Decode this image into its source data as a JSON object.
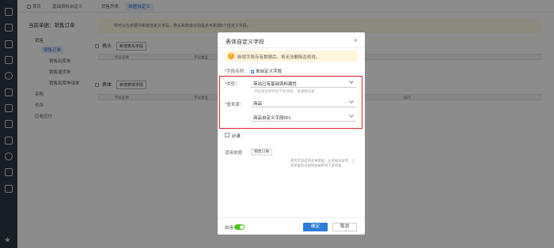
{
  "tabs": [
    "首页",
    "基础资料自定义",
    "销售列表",
    "单据自定义"
  ],
  "breadcrumb": "当前单据：销售订单",
  "tree": {
    "group": "销售",
    "items": [
      "销售订单",
      "销售出库单",
      "销售退货单",
      "销售出库申请单"
    ],
    "other_groups": [
      "采购",
      "仓存",
      "应收应付"
    ]
  },
  "background": {
    "tip": "你可以在单据中新增自定义字段，表头和表体分别最多可新增8个自定义字段。",
    "header_section": "表头",
    "header_add": "新增表头字段",
    "body_section": "表体",
    "body_add": "新增表体字段",
    "col_a": "字段名称",
    "col_b": "字段类型",
    "col_c": "操作"
  },
  "modal": {
    "title": "表体自定义字段",
    "warning": "新增字段存有数据后，将无法删除及修改。",
    "name_label": "*字段名称：",
    "name_value": "单自定义字段",
    "type_label": "*类型：",
    "type_value": "带出已有基础资料属性",
    "type_hint": "字段类型保存后不能修改，请谨慎设置",
    "source_label": "*值来源：",
    "source_value": "商品",
    "source_attr": "商品自定义字段001",
    "required_label": "必录",
    "apply_label": "适用单据",
    "apply_tag": "销售订单",
    "note": "新的字段适用多种单据，在单据关联时，上游单据的内容将会被带到下游单据",
    "enable_label": "启用",
    "ok_label": "确定",
    "cancel_label": "取消"
  },
  "colors": {
    "accent": "#2f7bd8",
    "highlight_border": "#e0262b",
    "toggle_on": "#52c41a",
    "warning": "#f5a623"
  }
}
